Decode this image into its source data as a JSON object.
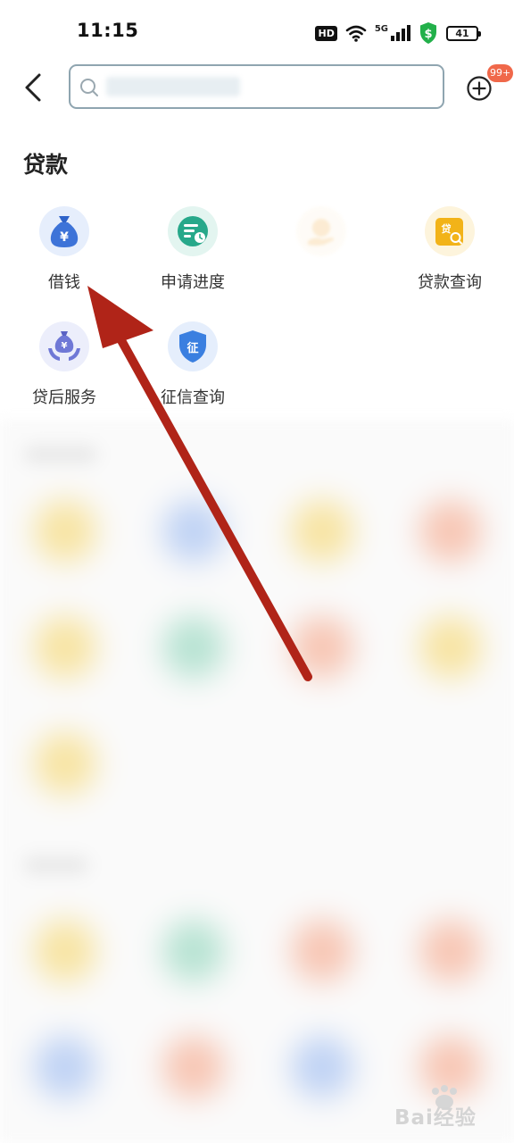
{
  "status_bar": {
    "time": "11:15",
    "hd_label": "HD",
    "network_label": "5G",
    "battery_level": "41",
    "icons": [
      "hd-icon",
      "wifi-icon",
      "signal-5g-icon",
      "security-shield-icon",
      "battery-icon"
    ]
  },
  "nav": {
    "back_icon": "chevron-left-icon",
    "search_placeholder": "",
    "add_icon": "plus-circle-icon",
    "notification_badge": "99+"
  },
  "section": {
    "title": "贷款",
    "items": [
      {
        "label": "借钱",
        "icon": "money-bag-yen-icon",
        "color": "#3d73d8"
      },
      {
        "label": "申请进度",
        "icon": "progress-list-icon",
        "color": "#27a88a"
      },
      {
        "label": "",
        "icon": "hand-money-icon",
        "color": "#f3a93a"
      },
      {
        "label": "贷款查询",
        "icon": "loan-search-icon",
        "color": "#f2b318"
      },
      {
        "label": "贷后服务",
        "icon": "hands-money-bag-icon",
        "color": "#6f78d6"
      },
      {
        "label": "征信查询",
        "icon": "credit-shield-icon",
        "color": "#3a7fe0"
      }
    ]
  },
  "annotation": {
    "type": "arrow",
    "color": "#b02418"
  },
  "watermark": {
    "text": "Bai经验",
    "icon": "baidu-paw-icon"
  },
  "colors": {
    "accent": "#f0684a",
    "border": "#8fa5b0"
  }
}
